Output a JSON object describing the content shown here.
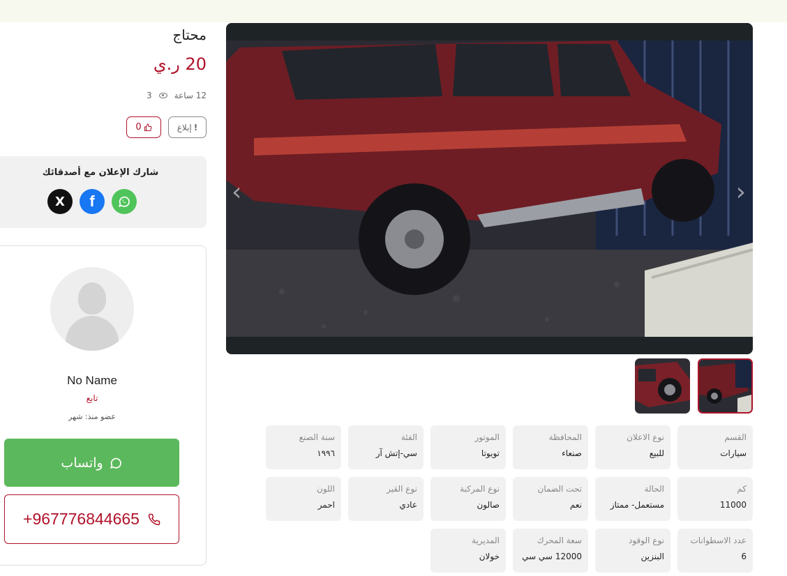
{
  "listing": {
    "title": "محتاج",
    "price": "20 ر.ي",
    "posted": "12 ساعة",
    "views": "3",
    "likes": "0",
    "report_label": "إبلاغ"
  },
  "share": {
    "title": "شارك الإعلان مع أصدقائك",
    "x_glyph": "X",
    "facebook_glyph": "f"
  },
  "seller": {
    "name": "No Name",
    "follow_label": "تابع",
    "member_since": "عضو منذ: شهر",
    "whatsapp_label": "واتساب",
    "phone": "+967776844665"
  },
  "gallery": {
    "prev_glyph": "‹",
    "next_glyph": "›"
  },
  "specs": [
    {
      "label": "القسم",
      "value": "سيارات"
    },
    {
      "label": "نوع الاعلان",
      "value": "للبيع"
    },
    {
      "label": "المحافظة",
      "value": "صنعاء"
    },
    {
      "label": "الموتور",
      "value": "تويوتا"
    },
    {
      "label": "الفئة",
      "value": "سي-إتش آر"
    },
    {
      "label": "سنة الصنع",
      "value": "١٩٩٦"
    },
    {
      "label": "كم",
      "value": "11000"
    },
    {
      "label": "الحالة",
      "value": "مستعمل- ممتاز"
    },
    {
      "label": "تحت الضمان",
      "value": "نعم"
    },
    {
      "label": "نوع المركبة",
      "value": "صالون"
    },
    {
      "label": "نوع القير",
      "value": "عادي"
    },
    {
      "label": "اللون",
      "value": "احمر"
    },
    {
      "label": "عدد الاسطوانات",
      "value": "6"
    },
    {
      "label": "نوع الوقود",
      "value": "البنزين"
    },
    {
      "label": "سعة المحرك",
      "value": "12000 سي سي"
    },
    {
      "label": "المديرية",
      "value": "خولان"
    }
  ],
  "colors": {
    "brand": "#b0122a",
    "whatsapp": "#5cb85c",
    "facebook": "#1877f2",
    "x": "#111111"
  }
}
